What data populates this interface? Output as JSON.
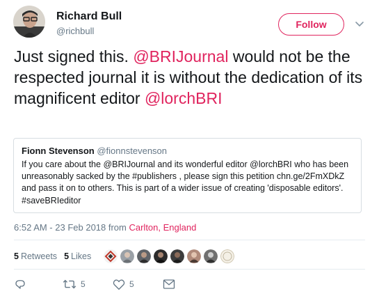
{
  "author": {
    "name": "Richard Bull",
    "handle": "@richbull",
    "avatar_icon": "profile-photo"
  },
  "follow_label": "Follow",
  "tweet": {
    "segments": [
      {
        "text": "Just signed this. ",
        "type": "text"
      },
      {
        "text": "@BRIJournal",
        "type": "mention"
      },
      {
        "text": " would not be the respected journal it is without the dedication of its magnificent editor ",
        "type": "text"
      },
      {
        "text": "@lorchBRI",
        "type": "mention"
      }
    ]
  },
  "quoted": {
    "name": "Fionn Stevenson",
    "handle": "@fionnstevenson",
    "lines": [
      "If you care about the @BRIJournal and its wonderful editor @lorchBRI who has been",
      "unreasonably sacked by the #publishers , please sign this petition chn.ge/2FmXDkZ",
      "and pass it on to others. This is part of a wider issue of creating 'disposable editors'.",
      "#saveBRIeditor"
    ]
  },
  "meta": {
    "time": "6:52 AM - 23 Feb 2018 from ",
    "location": "Carlton, England"
  },
  "stats": {
    "retweets_count": "5",
    "retweets_label": "Retweets",
    "likes_count": "5",
    "likes_label": "Likes"
  },
  "likers": [
    {
      "icon": "diamond-logo-avatar",
      "color": "#c0392b"
    },
    {
      "icon": "person-avatar",
      "color": "#9aa0a6"
    },
    {
      "icon": "person-avatar",
      "color": "#5f6368"
    },
    {
      "icon": "person-avatar",
      "color": "#2b2b2b"
    },
    {
      "icon": "person-avatar",
      "color": "#3c3c3c"
    },
    {
      "icon": "person-avatar",
      "color": "#b08a7a"
    },
    {
      "icon": "person-avatar",
      "color": "#707070"
    },
    {
      "icon": "badge-avatar",
      "color": "#e8e2d4"
    }
  ],
  "actions": {
    "reply_count": "",
    "retweet_count": "5",
    "like_count": "5"
  },
  "colors": {
    "accent": "#e0245e",
    "secondary_text": "#657786",
    "border": "#d7dde2",
    "divider": "#e6ecf0"
  }
}
